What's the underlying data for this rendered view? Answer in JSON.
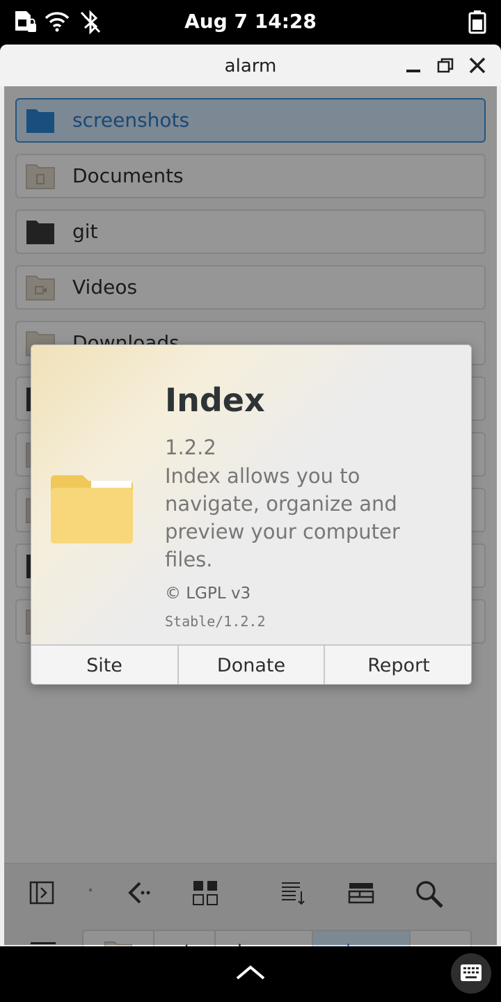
{
  "status_bar": {
    "time": "Aug 7  14:28",
    "icons": [
      "sim-locked-icon",
      "wifi-icon",
      "bluetooth-off-icon",
      "battery-icon"
    ]
  },
  "window": {
    "title": "alarm",
    "controls": [
      "minimize-icon",
      "maximize-icon",
      "close-icon"
    ]
  },
  "files": [
    {
      "name": "screenshots",
      "selected": true,
      "icon": "folder-blue-icon"
    },
    {
      "name": "Documents",
      "selected": false,
      "icon": "folder-documents-icon"
    },
    {
      "name": "git",
      "selected": false,
      "icon": "folder-dark-icon"
    },
    {
      "name": "Videos",
      "selected": false,
      "icon": "folder-videos-icon"
    },
    {
      "name": "Downloads",
      "selected": false,
      "icon": "folder-downloads-icon"
    }
  ],
  "toolbar": {
    "buttons": [
      "sidebar-toggle-icon",
      "go-back-icon",
      "view-grid-icon",
      "sort-icon",
      "view-columns-icon",
      "search-icon"
    ]
  },
  "breadcrumb": {
    "menu_icon": "hamburger-menu-icon",
    "home_icon": "home-folder-icon",
    "items": [
      "/",
      "home",
      "alarm"
    ],
    "active": "alarm",
    "extra": "⎵"
  },
  "about_dialog": {
    "app_name": "Index",
    "version": "1.2.2",
    "description": "Index allows you to navigate, organize and preview your computer files.",
    "license": "© LGPL v3",
    "build": "Stable/1.2.2",
    "buttons": [
      "Site",
      "Donate",
      "Report"
    ],
    "logo_icon": "folder-logo-icon"
  },
  "nav_bar": {
    "icons": [
      "chevron-up-icon",
      "keyboard-icon"
    ]
  },
  "colors": {
    "accent": "#3b8fd9",
    "folder_yellow": "#f7d77a"
  }
}
